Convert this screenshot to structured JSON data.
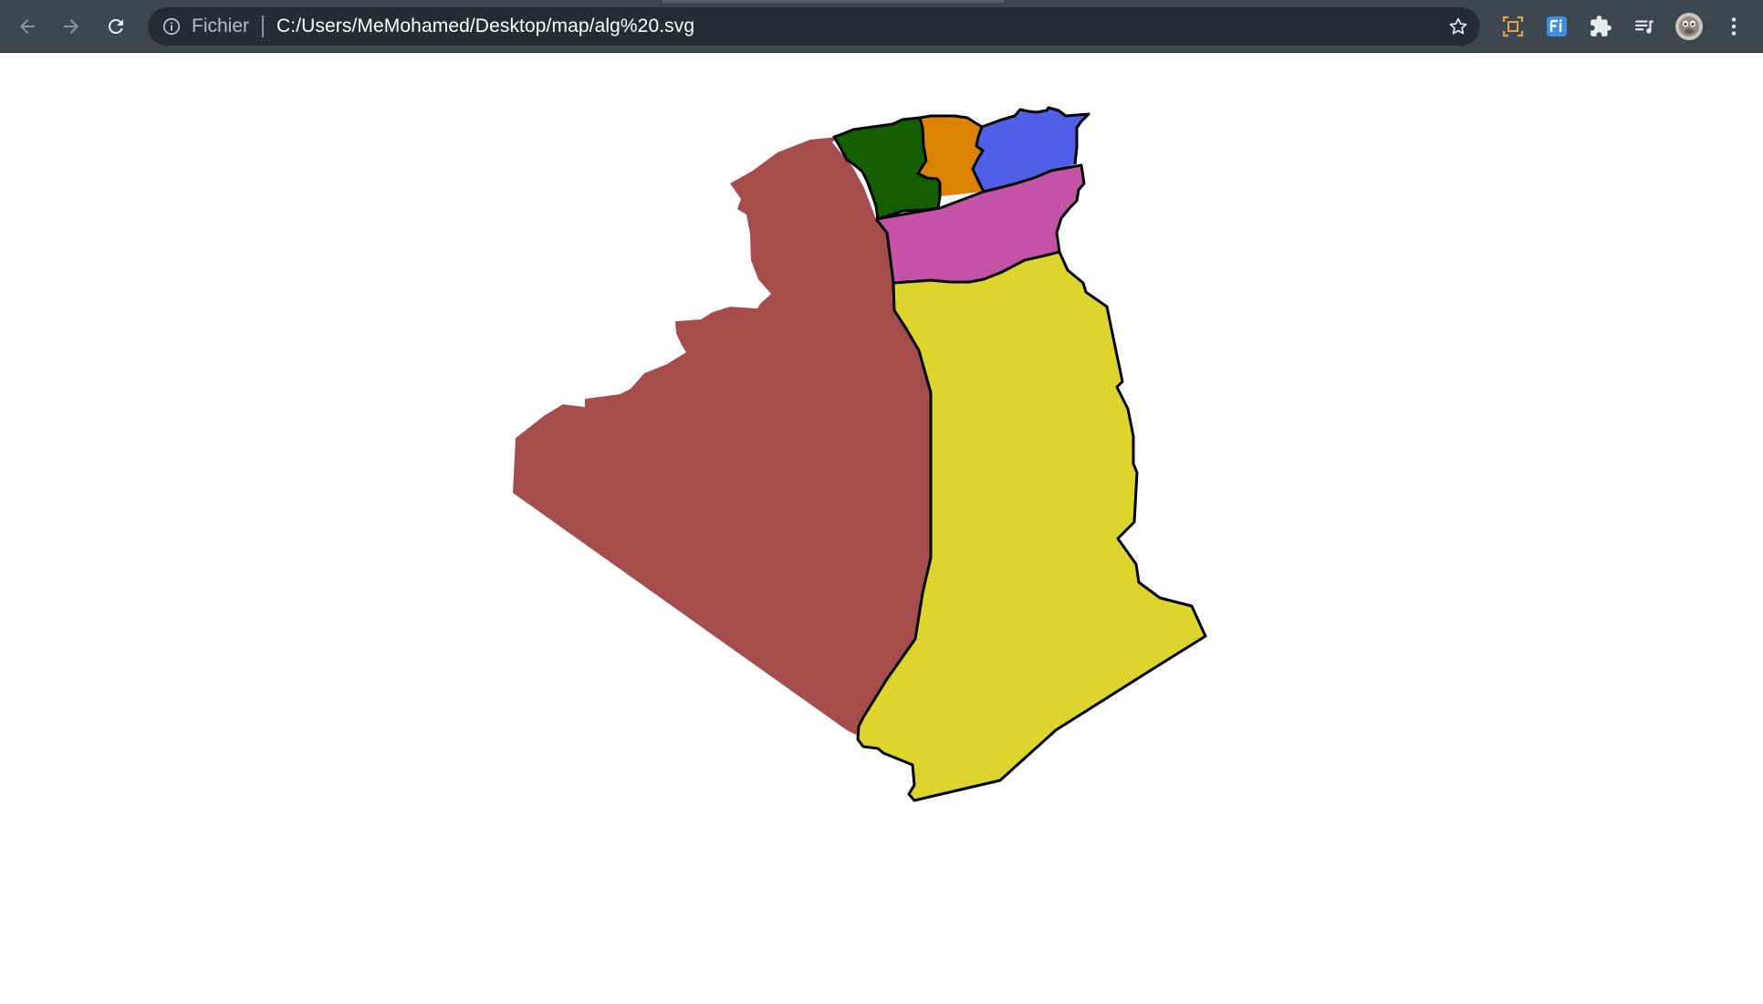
{
  "browser": {
    "scheme_label": "Fichier",
    "url": "C:/Users/MeMohamed/Desktop/map/alg%20.svg",
    "toolbar_icons": [
      "back-arrow-icon",
      "forward-arrow-icon",
      "reload-icon",
      "info-icon",
      "bookmark-star-icon",
      "screen-capture-icon",
      "translate-extension-icon",
      "extensions-puzzle-icon",
      "media-queue-icon",
      "profile-avatar",
      "more-menu-icon"
    ]
  },
  "map": {
    "regions": [
      {
        "id": "region-west",
        "fill": "#a54c4c"
      },
      {
        "id": "region-southeast",
        "fill": "#ddd42e"
      },
      {
        "id": "region-highlands",
        "fill": "#c452a6"
      },
      {
        "id": "region-north-green",
        "fill": "#135f01"
      },
      {
        "id": "region-north-orange",
        "fill": "#dd8200"
      },
      {
        "id": "region-northeast-blue",
        "fill": "#5060e6"
      }
    ],
    "stroke": "#000000"
  }
}
